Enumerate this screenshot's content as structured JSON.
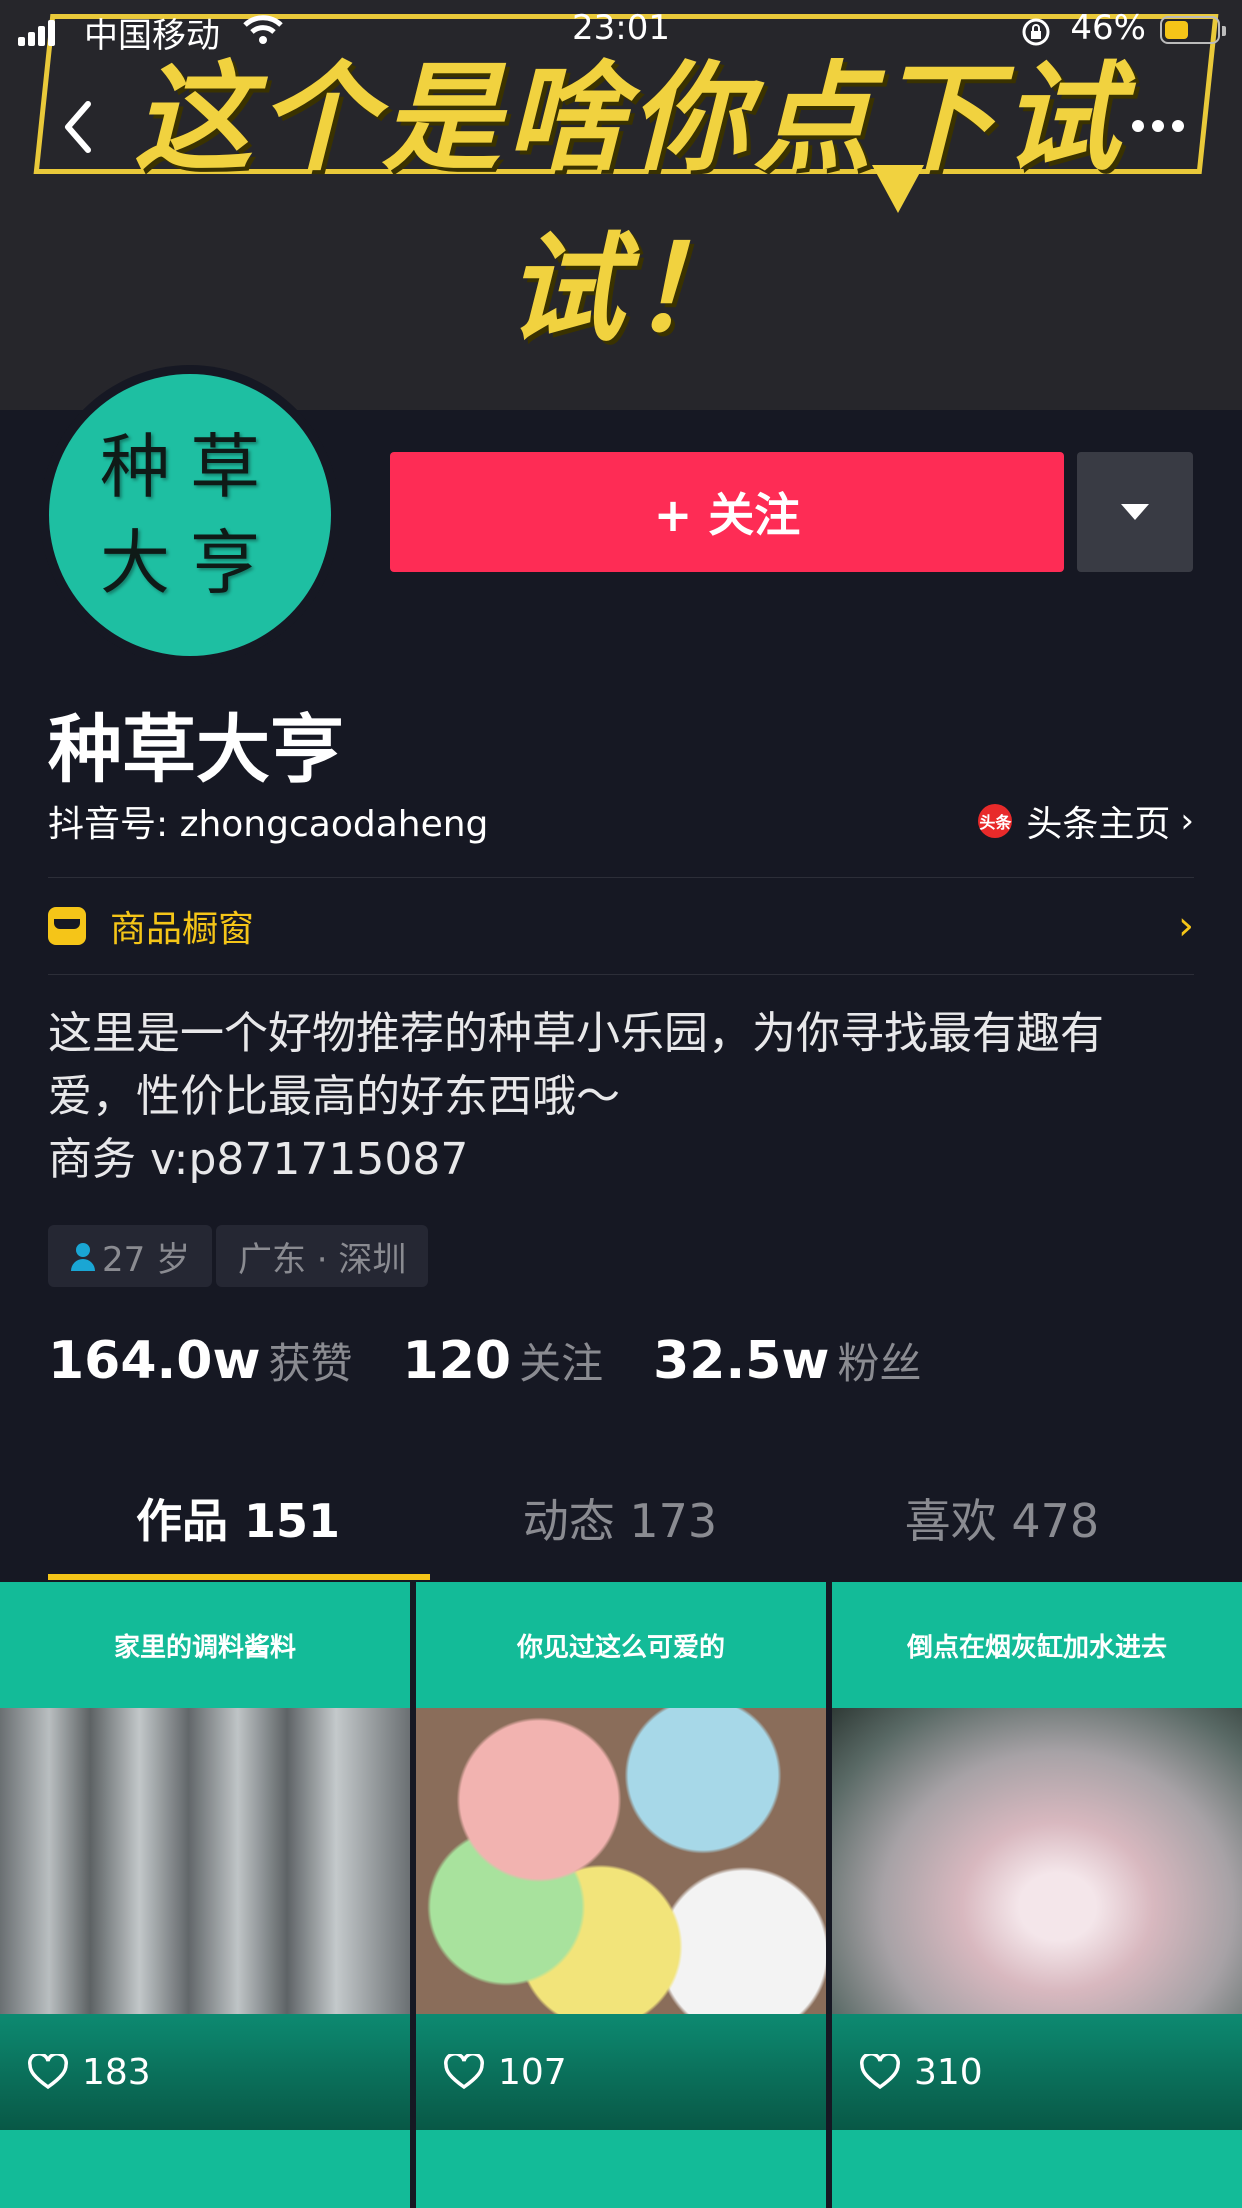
{
  "status_bar": {
    "carrier": "中国移动",
    "time": "23:01",
    "battery": "46%",
    "battery_level": 0.46
  },
  "banner": {
    "slogan": "这个是啥你点下试试！"
  },
  "avatar": {
    "line1": "种草",
    "line2": "大亨"
  },
  "follow": {
    "label": "+ 关注"
  },
  "profile": {
    "name": "种草大亨",
    "id_label": "抖音号: zhongcaodaheng",
    "toutiao_logo": "头条",
    "toutiao_link": "头条主页",
    "shop_label": "商品橱窗",
    "bio_line1": "这里是一个好物推荐的种草小乐园，为你寻找最有趣有",
    "bio_line2": "爱，性价比最高的好东西哦～",
    "bio_line3": "商务 v:p871715087",
    "tag_age": "27 岁",
    "tag_location": "广东 · 深圳"
  },
  "stats": [
    {
      "value": "164.0w",
      "label": "获赞"
    },
    {
      "value": "120",
      "label": "关注"
    },
    {
      "value": "32.5w",
      "label": "粉丝"
    }
  ],
  "tabs": [
    {
      "label": "作品 151"
    },
    {
      "label": "动态 173"
    },
    {
      "label": "喜欢 478"
    }
  ],
  "videos": [
    {
      "title": "家里的调料酱料",
      "likes": "183"
    },
    {
      "title": "你见过这么可爱的",
      "likes": "107"
    },
    {
      "title": "倒点在烟灰缸加水进去",
      "likes": "310"
    }
  ],
  "colors": {
    "background": "#161823",
    "follow": "#fe2c55",
    "accent": "#f5c518",
    "card_teal": "#13bb98"
  }
}
